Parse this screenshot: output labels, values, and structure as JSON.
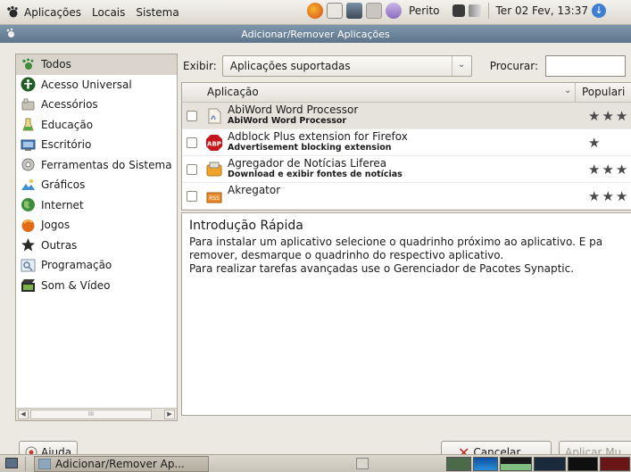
{
  "top_panel": {
    "menus": [
      "Aplicações",
      "Locais",
      "Sistema"
    ],
    "user": "Perito",
    "clock": "Ter 02 Fev, 13:37"
  },
  "window": {
    "title": "Adicionar/Remover Aplicações"
  },
  "sidebar": {
    "categories": [
      {
        "label": "Todos",
        "icon": "all-apps-icon",
        "selected": true
      },
      {
        "label": "Acesso Universal",
        "icon": "accessibility-icon"
      },
      {
        "label": "Acessórios",
        "icon": "accessories-icon"
      },
      {
        "label": "Educação",
        "icon": "education-icon"
      },
      {
        "label": "Escritório",
        "icon": "office-icon"
      },
      {
        "label": "Ferramentas do Sistema",
        "icon": "system-tools-icon"
      },
      {
        "label": "Gráficos",
        "icon": "graphics-icon"
      },
      {
        "label": "Internet",
        "icon": "internet-icon"
      },
      {
        "label": "Jogos",
        "icon": "games-icon"
      },
      {
        "label": "Outras",
        "icon": "other-icon"
      },
      {
        "label": "Programação",
        "icon": "programming-icon"
      },
      {
        "label": "Som & Vídeo",
        "icon": "sound-video-icon"
      }
    ],
    "hscroll_grip": "III"
  },
  "filter": {
    "show_label": "Exibir:",
    "show_value": "Aplicações suportadas",
    "search_label": "Procurar:",
    "search_value": ""
  },
  "table": {
    "columns": {
      "app": "Aplicação",
      "popularity": "Populari"
    },
    "rows": [
      {
        "name": "AbiWord Word Processor",
        "description": "AbiWord Word Processor",
        "stars": "★★★",
        "icon": "abiword-icon"
      },
      {
        "name": "Adblock Plus extension for Firefox",
        "description": "Advertisement blocking extension",
        "stars": "★",
        "icon": "adblock-icon"
      },
      {
        "name": "Agregador de Notícias Liferea",
        "description": "Download e exibir fontes de notícias",
        "stars": "★★★",
        "icon": "liferea-icon"
      },
      {
        "name": "Akregator",
        "description": "",
        "stars": "★★★",
        "icon": "akregator-icon"
      }
    ]
  },
  "info": {
    "title": "Introdução Rápida",
    "lines": [
      "Para instalar um aplicativo selecione o quadrinho próximo ao aplicativo. E pa",
      "remover, desmarque o quadrinho do respectivo aplicativo.",
      "Para realizar tarefas avançadas use o Gerenciador de Pacotes Synaptic."
    ]
  },
  "buttons": {
    "help": "Ajuda",
    "cancel": "Cancelar",
    "apply": "Aplicar Mu"
  },
  "taskbar": {
    "window_button": "Adicionar/Remover Ap..."
  }
}
